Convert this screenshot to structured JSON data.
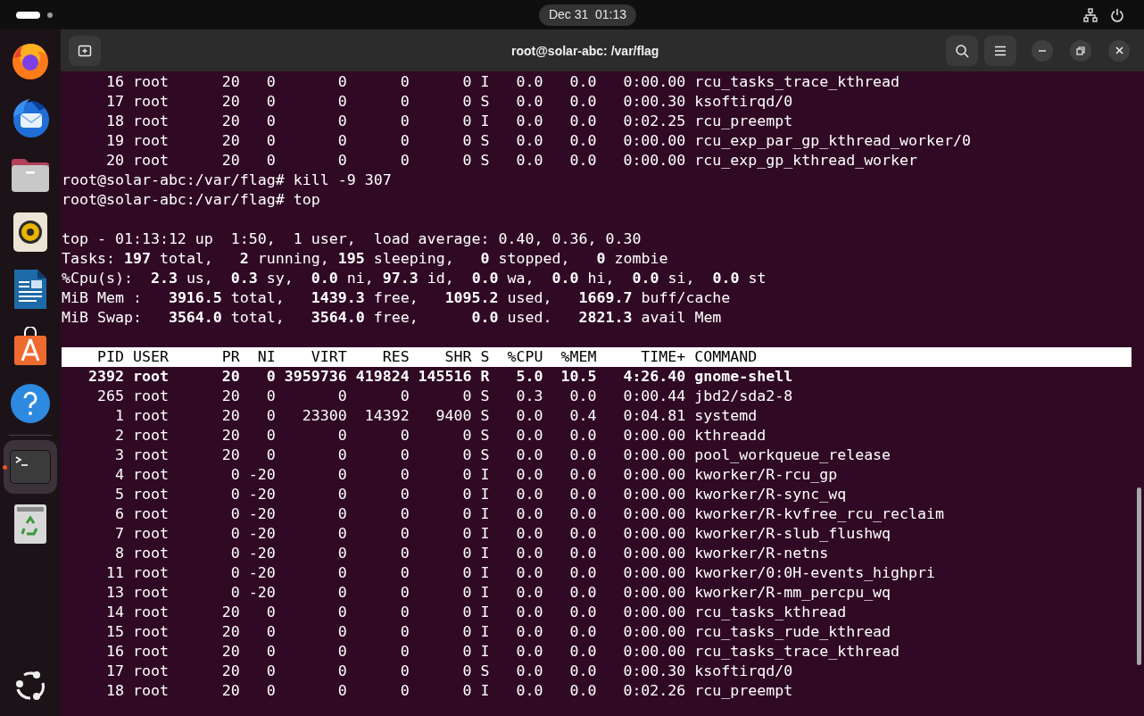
{
  "top_bar": {
    "clock": "Dec 31  01:13"
  },
  "dock": {
    "groups": [
      [
        {
          "running": false,
          "focused": false
        },
        {
          "running": false,
          "focused": false
        },
        {
          "running": false,
          "focused": false
        },
        {
          "running": false,
          "focused": false
        },
        {
          "running": false,
          "focused": false
        },
        {
          "running": false,
          "focused": false
        },
        {
          "running": false,
          "focused": false
        }
      ],
      [
        {
          "running": true,
          "focused": true
        },
        {
          "running": false,
          "focused": false
        }
      ]
    ]
  },
  "window": {
    "title": "root@solar-abc: /var/flag"
  },
  "terminal": {
    "lines": [
      {
        "kind": "text",
        "text": "     16 root      20   0       0      0      0 I   0.0   0.0   0:00.00 rcu_tasks_trace_kthread"
      },
      {
        "kind": "text",
        "text": "     17 root      20   0       0      0      0 S   0.0   0.0   0:00.30 ksoftirqd/0"
      },
      {
        "kind": "text",
        "text": "     18 root      20   0       0      0      0 I   0.0   0.0   0:02.25 rcu_preempt"
      },
      {
        "kind": "text",
        "text": "     19 root      20   0       0      0      0 S   0.0   0.0   0:00.00 rcu_exp_par_gp_kthread_worker/0"
      },
      {
        "kind": "text",
        "text": "     20 root      20   0       0      0      0 S   0.0   0.0   0:00.00 rcu_exp_gp_kthread_worker"
      },
      {
        "kind": "text",
        "text": "root@solar-abc:/var/flag# kill -9 307"
      },
      {
        "kind": "text",
        "text": "root@solar-abc:/var/flag# top"
      },
      {
        "kind": "blank"
      },
      {
        "kind": "text",
        "text": "top - 01:13:12 up  1:50,  1 user,  load average: 0.40, 0.36, 0.30"
      },
      {
        "kind": "text",
        "text": "Tasks: **197** total,   **2** running, **195** sleeping,   **0** stopped,   **0** zombie"
      },
      {
        "kind": "text",
        "text": "%Cpu(s):  **2.3** us,  **0.3** sy,  **0.0** ni, **97.3** id,  **0.0** wa,  **0.0** hi,  **0.0** si,  **0.0** st"
      },
      {
        "kind": "text",
        "text": "MiB Mem :   **3916.5** total,   **1439.3** free,   **1095.2** used,   **1669.7** buff/cache"
      },
      {
        "kind": "text",
        "text": "MiB Swap:   **3564.0** total,   **3564.0** free,      **0.0** used.   **2821.3** avail Mem"
      },
      {
        "kind": "blank"
      },
      {
        "kind": "header",
        "text": "    PID USER      PR  NI    VIRT    RES    SHR S  %CPU  %MEM     TIME+ COMMAND"
      },
      {
        "kind": "bold",
        "text": "   2392 root      20   0 3959736 419824 145516 R   5.0  10.5   4:26.40 gnome-shell"
      },
      {
        "kind": "text",
        "text": "    265 root      20   0       0      0      0 S   0.3   0.0   0:00.44 jbd2/sda2-8"
      },
      {
        "kind": "text",
        "text": "      1 root      20   0   23300  14392   9400 S   0.0   0.4   0:04.81 systemd"
      },
      {
        "kind": "text",
        "text": "      2 root      20   0       0      0      0 S   0.0   0.0   0:00.00 kthreadd"
      },
      {
        "kind": "text",
        "text": "      3 root      20   0       0      0      0 S   0.0   0.0   0:00.00 pool_workqueue_release"
      },
      {
        "kind": "text",
        "text": "      4 root       0 -20       0      0      0 I   0.0   0.0   0:00.00 kworker/R-rcu_gp"
      },
      {
        "kind": "text",
        "text": "      5 root       0 -20       0      0      0 I   0.0   0.0   0:00.00 kworker/R-sync_wq"
      },
      {
        "kind": "text",
        "text": "      6 root       0 -20       0      0      0 I   0.0   0.0   0:00.00 kworker/R-kvfree_rcu_reclaim"
      },
      {
        "kind": "text",
        "text": "      7 root       0 -20       0      0      0 I   0.0   0.0   0:00.00 kworker/R-slub_flushwq"
      },
      {
        "kind": "text",
        "text": "      8 root       0 -20       0      0      0 I   0.0   0.0   0:00.00 kworker/R-netns"
      },
      {
        "kind": "text",
        "text": "     11 root       0 -20       0      0      0 I   0.0   0.0   0:00.00 kworker/0:0H-events_highpri"
      },
      {
        "kind": "text",
        "text": "     13 root       0 -20       0      0      0 I   0.0   0.0   0:00.00 kworker/R-mm_percpu_wq"
      },
      {
        "kind": "text",
        "text": "     14 root      20   0       0      0      0 I   0.0   0.0   0:00.00 rcu_tasks_kthread"
      },
      {
        "kind": "text",
        "text": "     15 root      20   0       0      0      0 I   0.0   0.0   0:00.00 rcu_tasks_rude_kthread"
      },
      {
        "kind": "text",
        "text": "     16 root      20   0       0      0      0 I   0.0   0.0   0:00.00 rcu_tasks_trace_kthread"
      },
      {
        "kind": "text",
        "text": "     17 root      20   0       0      0      0 S   0.0   0.0   0:00.30 ksoftirqd/0"
      },
      {
        "kind": "text",
        "text": "     18 root      20   0       0      0      0 I   0.0   0.0   0:02.26 rcu_preempt"
      }
    ]
  }
}
